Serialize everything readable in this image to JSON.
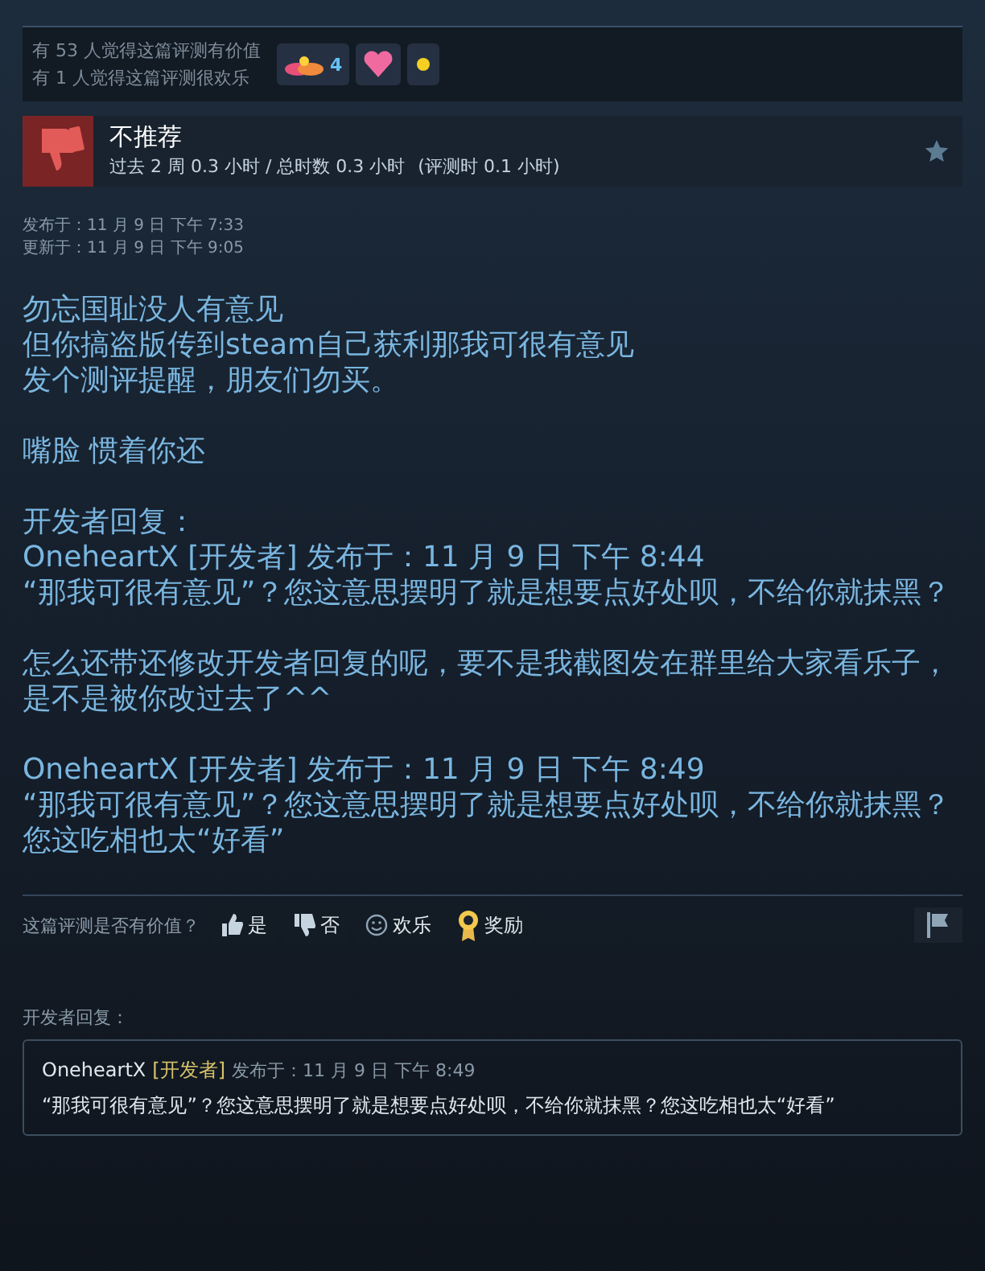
{
  "awards_bar": {
    "lines": [
      "有 53 人觉得这篇评测有价值",
      "有 1 人觉得这篇评测很欢乐"
    ],
    "awards": [
      {
        "kind": "clouds",
        "count": "4"
      },
      {
        "kind": "heart"
      },
      {
        "kind": "sparkle"
      }
    ]
  },
  "review_header": {
    "recommended": false,
    "verdict": "不推荐",
    "hours": "过去 2 周 0.3 小时 / 总时数 0.3 小时",
    "review_hours": "(评测时 0.1 小时)"
  },
  "dates": [
    "发布于：11 月 9 日 下午 7:33",
    "更新于：11 月 9 日 下午 9:05"
  ],
  "body": [
    {
      "lines": [
        "勿忘国耻没人有意见",
        "但你搞盗版传到steam自己获利那我可很有意见",
        "发个测评提醒，朋友们勿买。"
      ]
    },
    {
      "lines": [
        "嘴脸 惯着你还"
      ]
    },
    {
      "lines": [
        "开发者回复：",
        "OneheartX [开发者] 发布于：11 月 9 日 下午 8:44",
        "“那我可很有意见”？您这意思摆明了就是想要点好处呗，不给你就抹黑？"
      ]
    },
    {
      "lines": [
        "怎么还带还修改开发者回复的呢，要不是我截图发在群里给大家看乐子，是不是被你改过去了^^"
      ]
    },
    {
      "lines": [
        "OneheartX [开发者] 发布于：11 月 9 日 下午 8:49",
        "“那我可很有意见”？您这意思摆明了就是想要点好处呗，不给你就抹黑？您这吃相也太“好看”"
      ]
    }
  ],
  "helpful": {
    "prompt": "这篇评测是否有价值？",
    "buttons": [
      {
        "kind": "yes",
        "label": "是"
      },
      {
        "kind": "no",
        "label": "否"
      },
      {
        "kind": "funny",
        "label": "欢乐"
      },
      {
        "kind": "award",
        "label": "奖励"
      }
    ]
  },
  "developer_response": {
    "label": "开发者回复：",
    "author": "OneheartX",
    "role": "[开发者]",
    "date": "发布于：11 月 9 日 下午 8:49",
    "text": "“那我可很有意见”？您这意思摆明了就是想要点好处呗，不给你就抹黑？您这吃相也太“好看”"
  }
}
